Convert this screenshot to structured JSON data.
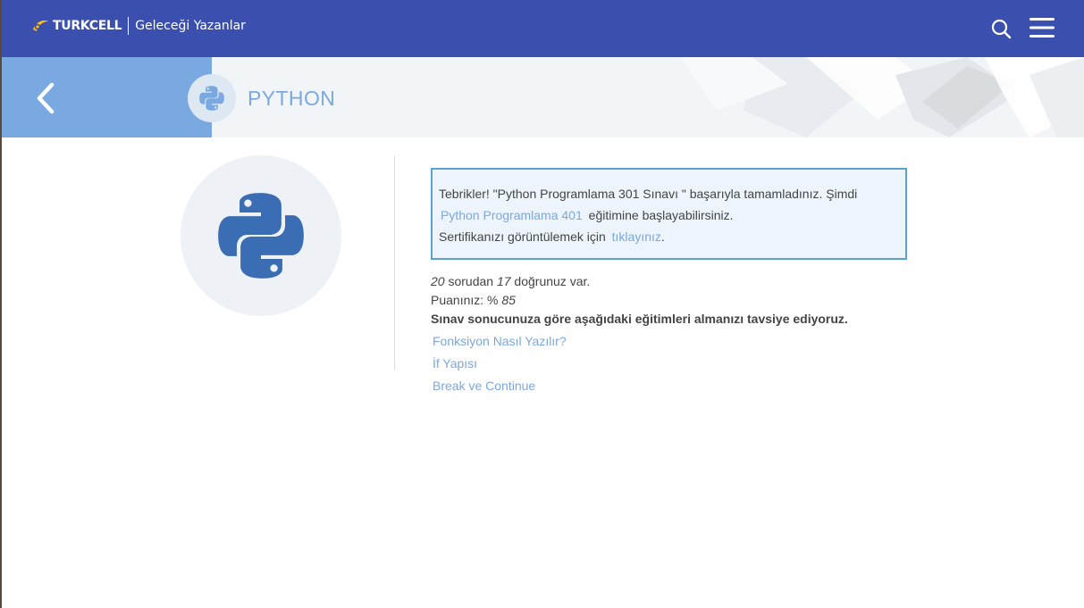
{
  "header": {
    "brand": "TURKCELL",
    "tagline": "Geleceği Yazanlar",
    "icons": {
      "search": "search-icon",
      "menu": "hamburger-menu-icon",
      "logo": "turkcell-logo-mark"
    },
    "colors": {
      "bar": "#3a4fae",
      "logo_accent": "#ffc20e"
    }
  },
  "banner": {
    "course_title": "PYTHON",
    "back_icon": "chevron-left-icon",
    "course_icon": "python-logo-icon",
    "colors": {
      "back_panel": "#7aa8e0",
      "title": "#7aa8e0"
    }
  },
  "result_message": {
    "line1": "Tebrikler! \"Python Programlama 301 Sınavı \" başarıyla tamamladınız. Şimdi",
    "next_course_link": "Python Programlama 401",
    "line2_suffix": "eğitimine başlayabilirsiniz.",
    "certificate_prefix": "Sertifikanızı görüntülemek için",
    "certificate_link": "tıklayınız",
    "certificate_suffix": "."
  },
  "score": {
    "total_questions": "20",
    "total_suffix": "sorudan",
    "correct": "17",
    "correct_suffix": "doğrunuz var.",
    "score_prefix": "Puanınız: %",
    "score_value": "85",
    "recommendation_heading": "Sınav sonucunuza göre aşağıdaki eğitimleri almanızı tavsiye ediyoruz."
  },
  "recommendations": [
    "Fonksiyon Nasıl Yazılır?",
    "İf Yapısı",
    "Break ve Continue"
  ],
  "theme": {
    "link_color": "#7aa8e0",
    "message_border": "#5ba1d6",
    "message_bg": "#edf4fb",
    "python_blue": "#3a6db3"
  }
}
